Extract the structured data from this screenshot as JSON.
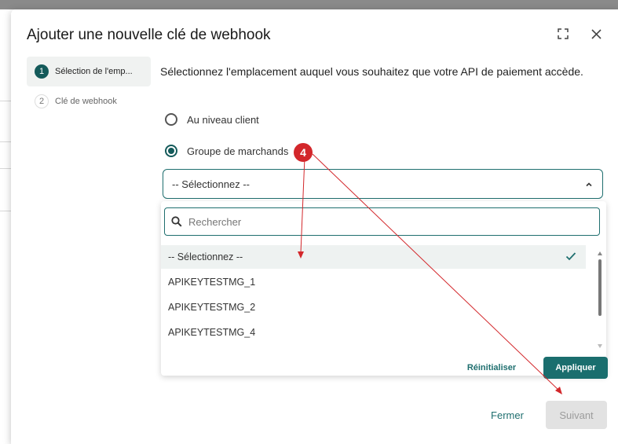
{
  "modal": {
    "title": "Ajouter une nouvelle clé de webhook",
    "expand_icon": "expand-icon",
    "close_icon": "close-icon"
  },
  "steps": [
    {
      "num": "1",
      "label": "Sélection de l'emp...",
      "active": true
    },
    {
      "num": "2",
      "label": "Clé de webhook",
      "active": false
    }
  ],
  "content": {
    "description": "Sélectionnez l'emplacement auquel vous souhaitez que votre API de paiement accède.",
    "options": [
      {
        "label": "Au niveau client",
        "checked": false
      },
      {
        "label": "Groupe de marchands",
        "checked": true
      }
    ],
    "select": {
      "value": "-- Sélectionnez --",
      "search_placeholder": "Rechercher",
      "items": [
        {
          "label": "-- Sélectionnez --",
          "selected": true
        },
        {
          "label": "APIKEYTESTMG_1",
          "selected": false
        },
        {
          "label": "APIKEYTESTMG_2",
          "selected": false
        },
        {
          "label": "APIKEYTESTMG_4",
          "selected": false
        }
      ],
      "reset_label": "Réinitialiser",
      "apply_label": "Appliquer"
    }
  },
  "footer": {
    "close_label": "Fermer",
    "next_label": "Suivant"
  },
  "annotation": {
    "badge": "4"
  },
  "colors": {
    "accent": "#1a6e6e",
    "badge": "#d3272b",
    "disabled_bg": "#e2e2e2"
  }
}
